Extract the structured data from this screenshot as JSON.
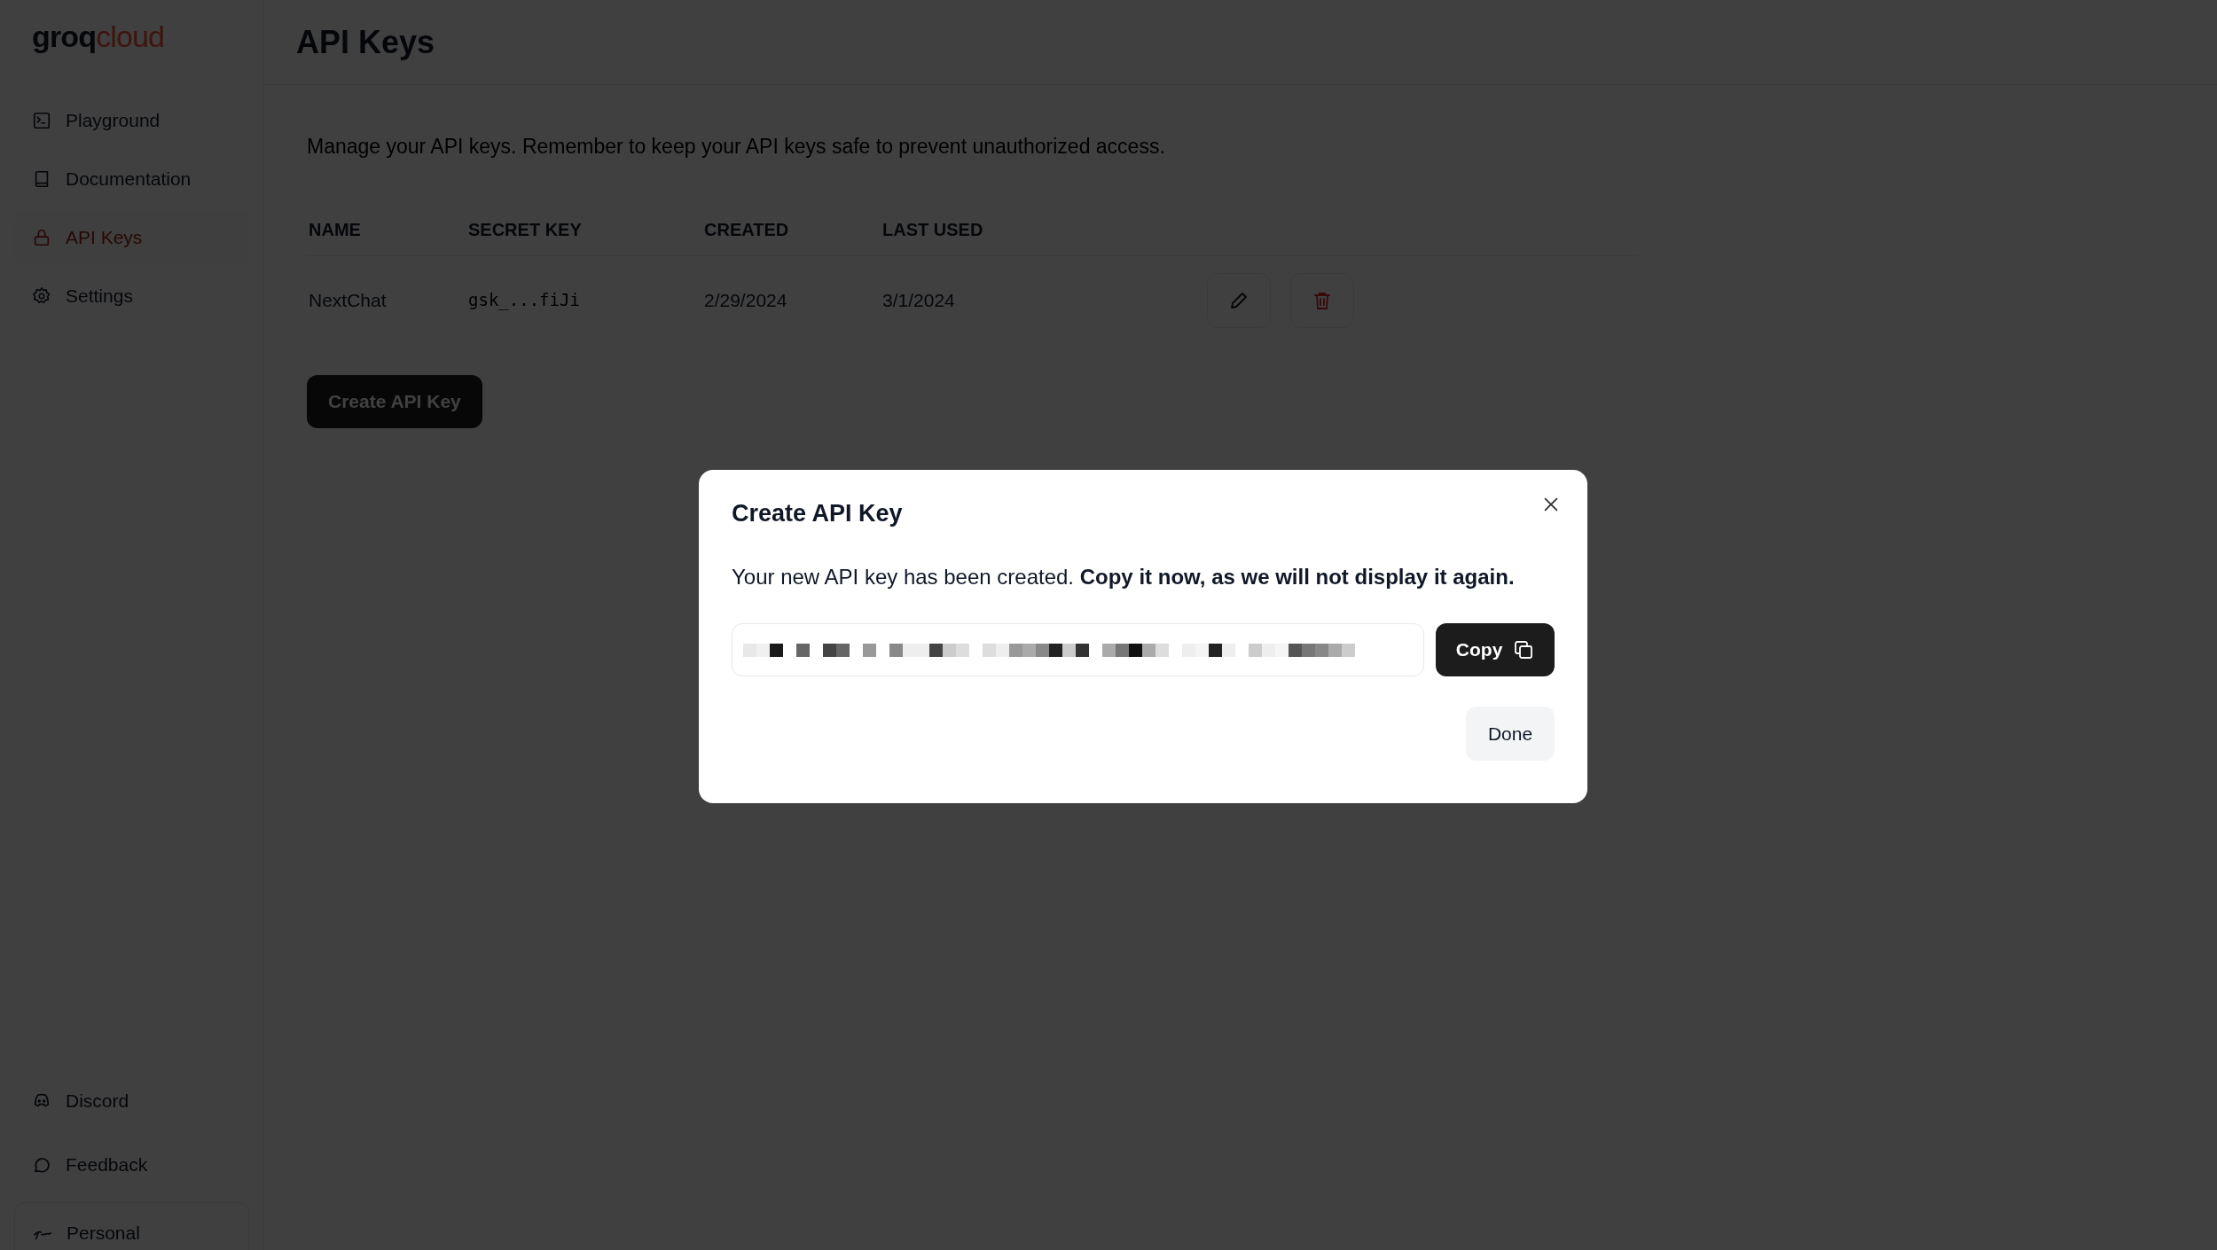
{
  "logo": {
    "primary": "groq",
    "secondary": "cloud"
  },
  "sidebar": {
    "items": [
      {
        "kind": "playground",
        "label": "Playground",
        "selected": false
      },
      {
        "kind": "docs",
        "label": "Documentation",
        "selected": false
      },
      {
        "kind": "keys",
        "label": "API Keys",
        "selected": true
      },
      {
        "kind": "settings",
        "label": "Settings",
        "selected": false
      }
    ],
    "footer_items": [
      {
        "kind": "discord",
        "label": "Discord"
      },
      {
        "kind": "feedback",
        "label": "Feedback"
      },
      {
        "kind": "account",
        "label": "Personal"
      }
    ]
  },
  "page": {
    "title": "API Keys",
    "description": "Manage your API keys. Remember to keep your API keys safe to prevent unauthorized access."
  },
  "table": {
    "columns": [
      "NAME",
      "SECRET KEY",
      "CREATED",
      "LAST USED"
    ],
    "rows": [
      {
        "name": "NextChat",
        "secret_key": "gsk_...fiJi",
        "created": "2/29/2024",
        "last_used": "3/1/2024"
      }
    ]
  },
  "create_button": "Create API Key",
  "dialog": {
    "title": "Create API Key",
    "message": "Your new API key has been created. **Copy it now, as we will not display it again.**",
    "copy_button": "Copy",
    "done_button": "Done"
  }
}
